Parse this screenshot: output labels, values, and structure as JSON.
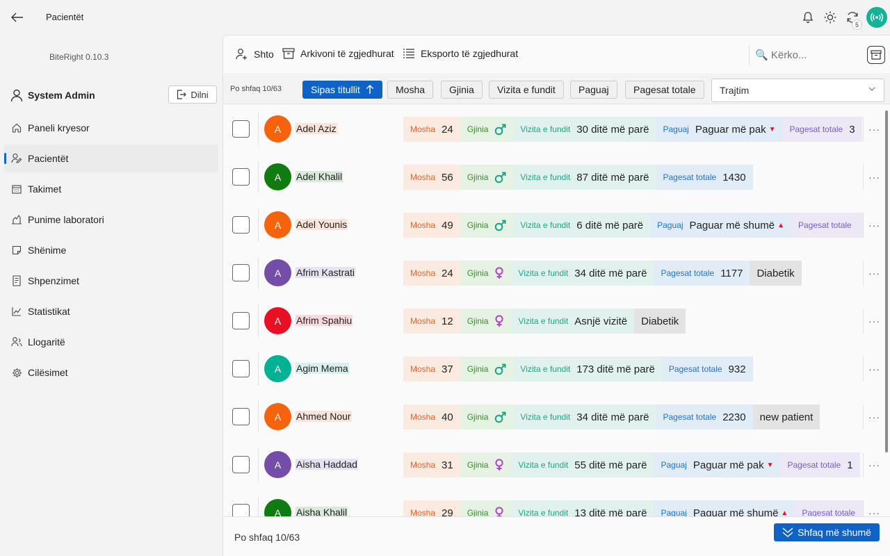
{
  "window": {
    "title": "Pacientët"
  },
  "top_icons": [
    "bell-icon",
    "sun-icon",
    "sync-icon",
    "broadcast-icon"
  ],
  "sync_count": "5",
  "sidebar": {
    "app_version": "BiteRight  0.10.3",
    "user": {
      "name": "System Admin",
      "logout_label": "Dilni"
    },
    "items": [
      {
        "label": "Paneli kryesor",
        "icon": "home-icon"
      },
      {
        "label": "Pacientët",
        "icon": "patients-icon",
        "active": true
      },
      {
        "label": "Takimet",
        "icon": "calendar-icon"
      },
      {
        "label": "Punime laboratori",
        "icon": "lab-icon"
      },
      {
        "label": "Shënime",
        "icon": "note-icon"
      },
      {
        "label": "Shpenzimet",
        "icon": "receipt-icon"
      },
      {
        "label": "Statistikat",
        "icon": "chart-icon"
      },
      {
        "label": "Llogaritë",
        "icon": "accounts-icon"
      },
      {
        "label": "Cilësimet",
        "icon": "gear-icon"
      }
    ]
  },
  "toolbar": {
    "add_label": "Shto",
    "archive_label": "Arkivoni të zgjedhurat",
    "export_label": "Eksporto të zgjedhurat",
    "search_placeholder": "🔍 Kërko..."
  },
  "sortbar": {
    "showing": "Po shfaq 10/63",
    "chips": [
      "Sipas titullit",
      "Mosha",
      "Gjinia",
      "Vizita e fundit",
      "Paguaj",
      "Pagesat totale"
    ],
    "active_chip": "Sipas titullit",
    "select_value": "Trajtim"
  },
  "labels": {
    "age": "Mosha",
    "gender": "Gjinia",
    "last_visit": "Vizita e fundit",
    "pay": "Paguaj",
    "total": "Pagesat totale"
  },
  "patients": [
    {
      "initial": "A",
      "name": "Adel Aziz",
      "avatar_color": "#f7630c",
      "age": "24",
      "gender": "male",
      "last_visit": "30 ditë më parë",
      "pay": "Paguar më pak",
      "pay_dir": "down",
      "total": "3",
      "note": ""
    },
    {
      "initial": "A",
      "name": "Adel Khalil",
      "avatar_color": "#107c10",
      "age": "56",
      "gender": "male",
      "last_visit": "87 ditë më parë",
      "pay": "",
      "total": "1430",
      "note": ""
    },
    {
      "initial": "A",
      "name": "Adel Younis",
      "avatar_color": "#f7630c",
      "age": "49",
      "gender": "male",
      "last_visit": "6 ditë më parë",
      "pay": "Paguar më shumë",
      "pay_dir": "up",
      "total": "",
      "note": ""
    },
    {
      "initial": "A",
      "name": "Afrim Kastrati",
      "avatar_color": "#744da9",
      "age": "24",
      "gender": "female",
      "last_visit": "34 ditë më parë",
      "pay": "",
      "total": "1177",
      "note": "Diabetik"
    },
    {
      "initial": "A",
      "name": "Afrim Spahiu",
      "avatar_color": "#e81123",
      "age": "12",
      "gender": "female",
      "last_visit": "Asnjë vizitë",
      "pay": "",
      "total": null,
      "note": "Diabetik"
    },
    {
      "initial": "A",
      "name": "Agim Mema",
      "avatar_color": "#00b294",
      "age": "37",
      "gender": "male",
      "last_visit": "173 ditë më parë",
      "pay": "",
      "total": "932",
      "note": ""
    },
    {
      "initial": "A",
      "name": "Ahmed Nour",
      "avatar_color": "#f7630c",
      "age": "40",
      "gender": "male",
      "last_visit": "34 ditë më parë",
      "pay": "",
      "total": "2230",
      "note": "new patient"
    },
    {
      "initial": "A",
      "name": "Aisha Haddad",
      "avatar_color": "#744da9",
      "age": "31",
      "gender": "female",
      "last_visit": "55 ditë më parë",
      "pay": "Paguar më pak",
      "pay_dir": "down",
      "total": "1",
      "note": ""
    },
    {
      "initial": "A",
      "name": "Aisha Khalil",
      "avatar_color": "#107c10",
      "age": "29",
      "gender": "female",
      "last_visit": "13 ditë më parë",
      "pay": "Paguar më shumë",
      "pay_dir": "up",
      "total": "",
      "note": ""
    }
  ],
  "colors": {
    "accent": "#0f63c7",
    "male": "#1aa58a",
    "female": "#b146c2",
    "pay_down": "#e81123",
    "pay_up": "#e81123"
  },
  "footer": {
    "showing": "Po shfaq 10/63",
    "more_label": "Shfaq më shumë"
  }
}
